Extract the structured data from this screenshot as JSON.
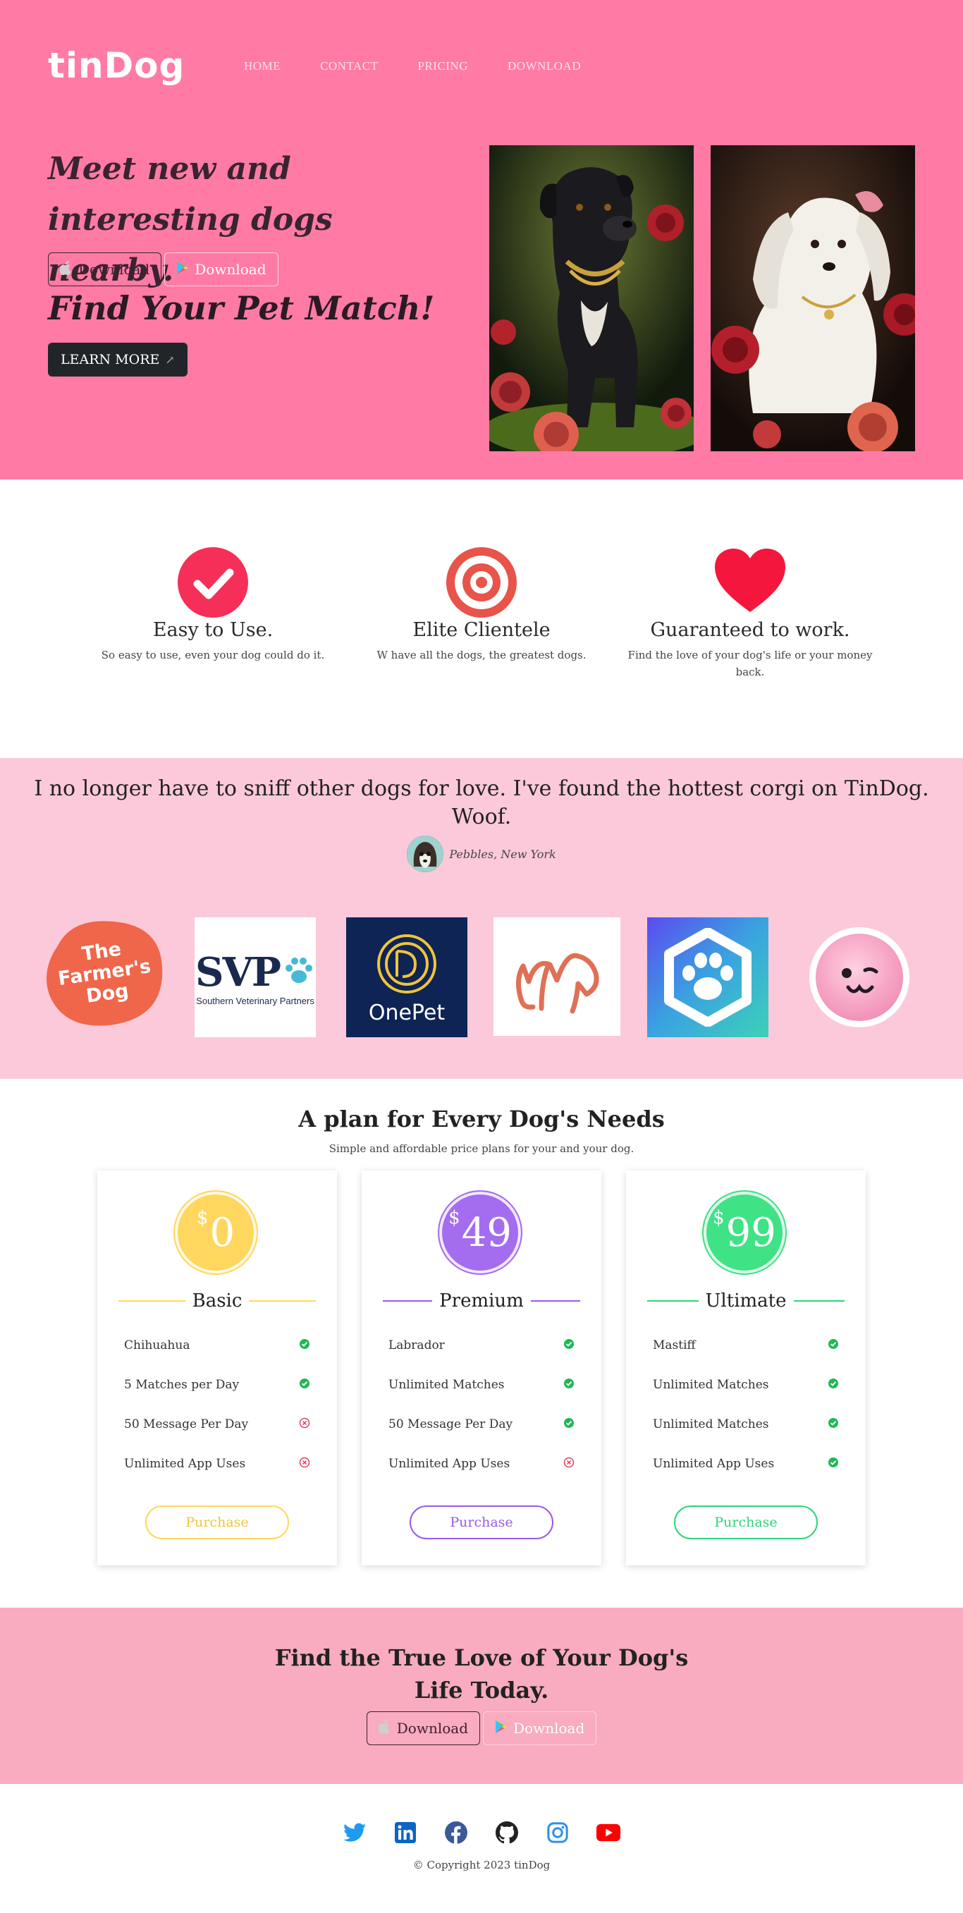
{
  "nav": {
    "brand": "tinDog",
    "links": [
      "HOME",
      "CONTACT",
      "PRICING",
      "DOWNLOAD"
    ]
  },
  "hero": {
    "title": "Meet new and interesting dogs nearby.",
    "download_apple": "Download",
    "download_google": "Download",
    "subtitle": "Find Your Pet Match!",
    "learn_more": "LEARN MORE",
    "learn_more_icon": "arrow-up-right-icon"
  },
  "features": [
    {
      "icon": "circle-check-icon",
      "title": "Easy to Use.",
      "text": "So easy to use, even your dog could do it."
    },
    {
      "icon": "bullseye-icon",
      "title": "Elite Clientele",
      "text": "W have all the dogs, the greatest dogs."
    },
    {
      "icon": "heart-icon",
      "title": "Guaranteed to work.",
      "text": "Find the love of your dog's life or your money back."
    }
  ],
  "testimonial": {
    "quote": "I no longer have to sniff other dogs for love. I've found the hottest corgi on TinDog. Woof.",
    "author": "Pebbles, New York"
  },
  "logos": {
    "farmers_dog": [
      "The",
      "Farmer's",
      "Dog"
    ],
    "svp": {
      "name": "SVP",
      "subtitle": "Southern Veterinary Partners"
    },
    "onepet": "OnePet"
  },
  "pricing": {
    "title": "A plan for Every Dog's Needs",
    "subtitle": "Simple and affordable price plans for your and your dog.",
    "currency": "$",
    "plans": [
      {
        "name": "Basic",
        "price": "0",
        "color": "#ffd75e",
        "accent": "#ffd75e",
        "features": [
          {
            "label": "Chihuahua",
            "included": true
          },
          {
            "label": "5 Matches per Day",
            "included": true
          },
          {
            "label": "50 Message Per Day",
            "included": false
          },
          {
            "label": "Unlimited App Uses",
            "included": false
          }
        ],
        "button": "Purchase"
      },
      {
        "name": "Premium",
        "price": "49",
        "color": "#a46df0",
        "accent": "#9b59e6",
        "features": [
          {
            "label": "Labrador",
            "included": true
          },
          {
            "label": "Unlimited Matches",
            "included": true
          },
          {
            "label": "50 Message Per Day",
            "included": true
          },
          {
            "label": "Unlimited App Uses",
            "included": false
          }
        ],
        "button": "Purchase"
      },
      {
        "name": "Ultimate",
        "price": "99",
        "color": "#3fe285",
        "accent": "#2ed47a",
        "features": [
          {
            "label": "Mastiff",
            "included": true
          },
          {
            "label": "Unlimited Matches",
            "included": true
          },
          {
            "label": "Unlimited Matches",
            "included": true
          },
          {
            "label": "Unlimited App Uses",
            "included": true
          }
        ],
        "button": "Purchase"
      }
    ]
  },
  "cta": {
    "title_line1": "Find the True Love of Your Dog's",
    "title_line2": "Life Today.",
    "download_apple": "Download",
    "download_google": "Download"
  },
  "footer": {
    "socials": [
      "twitter-icon",
      "linkedin-icon",
      "facebook-icon",
      "github-icon",
      "instagram-icon",
      "youtube-icon"
    ],
    "copyright": "© Copyright 2023 tinDog"
  },
  "colors": {
    "hero_bg": "#ff7ba5",
    "testimonial_bg": "#fcc9da",
    "cta_bg": "#f9abbf",
    "feature_red": "#f52f57",
    "check_green": "#1db954",
    "cross_red": "#e04060"
  }
}
